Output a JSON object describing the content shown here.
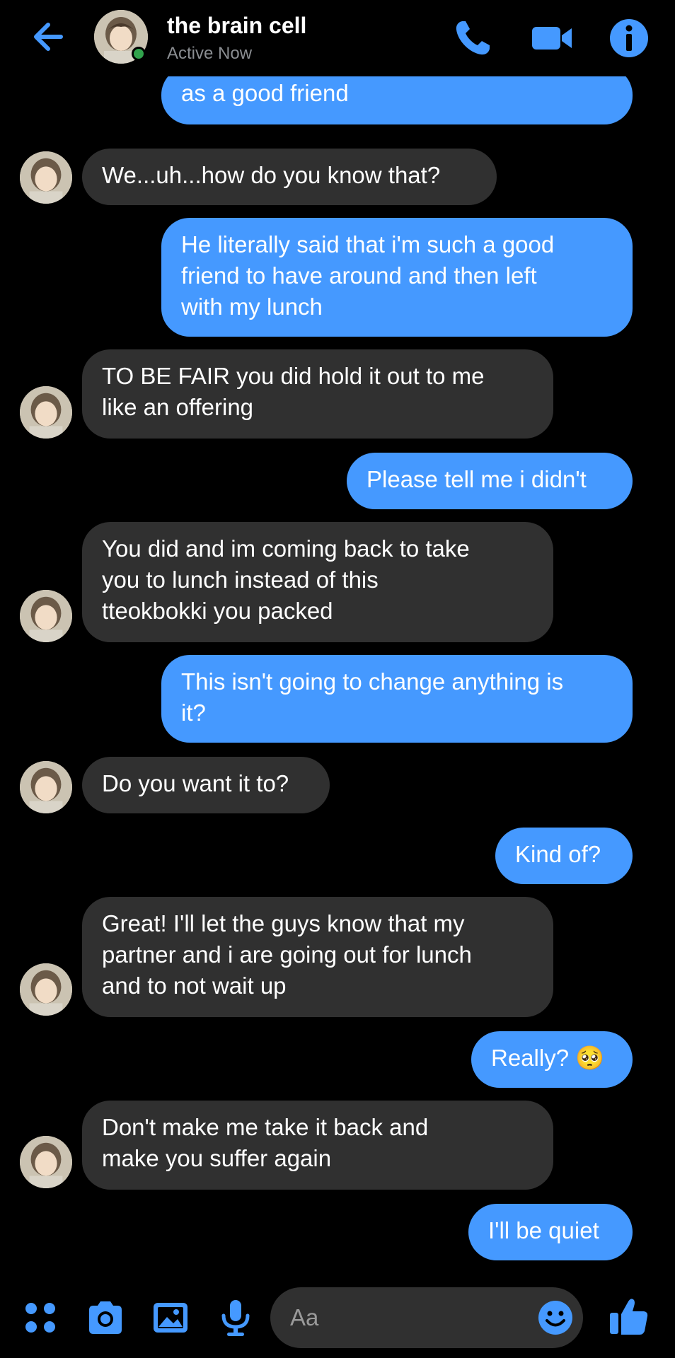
{
  "header": {
    "contact_name": "the brain cell",
    "status": "Active Now"
  },
  "colors": {
    "accent": "#4599ff",
    "sent_bubble": "#4599ff",
    "received_bubble": "#303030",
    "online": "#31a24c"
  },
  "messages": [
    {
      "from": "me",
      "text": "as a good friend"
    },
    {
      "from": "them",
      "text": "We...uh...how do you know that?"
    },
    {
      "from": "me",
      "text": "He literally said that i'm such a good\nfriend to have around and then left\nwith my lunch"
    },
    {
      "from": "them",
      "text": "TO BE FAIR you did hold it out to me\nlike an offering"
    },
    {
      "from": "me",
      "text": "Please tell me i didn't"
    },
    {
      "from": "them",
      "text": "You did and im coming back to take\nyou to lunch instead of this\ntteokbokki you packed"
    },
    {
      "from": "me",
      "text": "This isn't going to change anything is\nit?"
    },
    {
      "from": "them",
      "text": "Do you want it to?"
    },
    {
      "from": "me",
      "text": "Kind of?"
    },
    {
      "from": "them",
      "text": "Great! I'll let the guys know that my\npartner and i are going out for lunch\nand to not wait up"
    },
    {
      "from": "me",
      "text": "Really? 🥺"
    },
    {
      "from": "them",
      "text": "Don't make me take it back and\nmake you suffer again"
    },
    {
      "from": "me",
      "text": "I'll be quiet"
    }
  ],
  "composer": {
    "placeholder": "Aa"
  }
}
